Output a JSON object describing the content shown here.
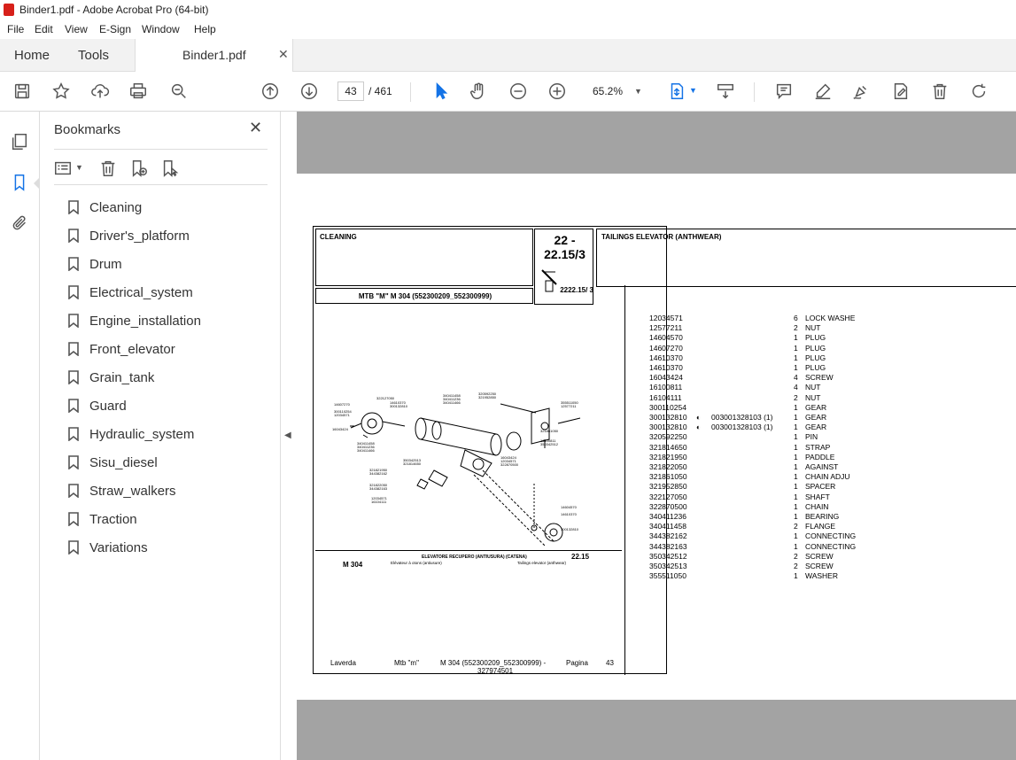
{
  "window": {
    "title": "Binder1.pdf - Adobe Acrobat Pro (64-bit)"
  },
  "menu": [
    "File",
    "Edit",
    "View",
    "E-Sign",
    "Window",
    "Help"
  ],
  "tabs": {
    "home": "Home",
    "tools": "Tools",
    "doc": "Binder1.pdf"
  },
  "toolbar": {
    "page_current": "43",
    "page_total": "/ 461",
    "zoom": "65.2%"
  },
  "bookmarks": {
    "title": "Bookmarks",
    "items": [
      "Cleaning",
      "Driver's_platform",
      "Drum",
      "Electrical_system",
      "Engine_installation",
      "Front_elevator",
      "Grain_tank",
      "Guard",
      "Hydraulic_system",
      "Sisu_diesel",
      "Straw_walkers",
      "Traction",
      "Variations"
    ]
  },
  "doc": {
    "section": "CLEANING",
    "code1": "22 -",
    "code2": "22.15/3",
    "code_small": "2222.15/ 3",
    "heading": "TAILINGS ELEVATOR (ANTHWEAR)",
    "model": "MTB \"M\" M 304 (552300209_552300999)",
    "fig_model": "M 304",
    "fig_title": "ELEVATORE RECUPERO (ANTIUSURA) (CATENA)",
    "fig_sub1": "Elévateur à otons (antiusure)",
    "fig_sub2": "Tailings elevator (anthwear)",
    "fig_code": "22.15",
    "footer": {
      "brand": "Laverda",
      "mtb": "Mtb \"m\"",
      "model": "M 304 (552300209_552300999) -",
      "page_label": "Pagina",
      "page_no": "43",
      "sub": "327974501"
    },
    "parts": [
      {
        "code": "12034571",
        "qty": "6",
        "desc": "LOCK WASHE",
        "note": ""
      },
      {
        "code": "12577211",
        "qty": "2",
        "desc": "NUT",
        "note": ""
      },
      {
        "code": "14604570",
        "qty": "1",
        "desc": "PLUG",
        "note": ""
      },
      {
        "code": "14607270",
        "qty": "1",
        "desc": "PLUG",
        "note": ""
      },
      {
        "code": "14610370",
        "qty": "1",
        "desc": "PLUG",
        "note": ""
      },
      {
        "code": "14610370",
        "qty": "1",
        "desc": "PLUG",
        "note": ""
      },
      {
        "code": "16043424",
        "qty": "4",
        "desc": "SCREW",
        "note": ""
      },
      {
        "code": "16100811",
        "qty": "4",
        "desc": "NUT",
        "note": ""
      },
      {
        "code": "16104111",
        "qty": "2",
        "desc": "NUT",
        "note": ""
      },
      {
        "code": "300110254",
        "qty": "1",
        "desc": "GEAR",
        "note": ""
      },
      {
        "code": "300132810",
        "qty": "1",
        "desc": "GEAR",
        "note": "003001328103  (1)"
      },
      {
        "code": "300132810",
        "qty": "1",
        "desc": "GEAR",
        "note": "003001328103  (1)"
      },
      {
        "code": "320592250",
        "qty": "1",
        "desc": "PIN",
        "note": ""
      },
      {
        "code": "321814650",
        "qty": "1",
        "desc": "STRAP",
        "note": ""
      },
      {
        "code": "321821950",
        "qty": "1",
        "desc": "PADDLE",
        "note": ""
      },
      {
        "code": "321822050",
        "qty": "1",
        "desc": "AGAINST",
        "note": ""
      },
      {
        "code": "321861050",
        "qty": "1",
        "desc": "CHAIN ADJU",
        "note": ""
      },
      {
        "code": "321952850",
        "qty": "1",
        "desc": "SPACER",
        "note": ""
      },
      {
        "code": "322127050",
        "qty": "1",
        "desc": "SHAFT",
        "note": ""
      },
      {
        "code": "322870500",
        "qty": "1",
        "desc": "CHAIN",
        "note": ""
      },
      {
        "code": "340411236",
        "qty": "1",
        "desc": "BEARING",
        "note": ""
      },
      {
        "code": "340411458",
        "qty": "2",
        "desc": "FLANGE",
        "note": ""
      },
      {
        "code": "344382162",
        "qty": "1",
        "desc": "CONNECTING",
        "note": ""
      },
      {
        "code": "344382163",
        "qty": "1",
        "desc": "CONNECTING",
        "note": ""
      },
      {
        "code": "350342512",
        "qty": "2",
        "desc": "SCREW",
        "note": ""
      },
      {
        "code": "350342513",
        "qty": "2",
        "desc": "SCREW",
        "note": ""
      },
      {
        "code": "355511050",
        "qty": "1",
        "desc": "WASHER",
        "note": ""
      }
    ]
  }
}
